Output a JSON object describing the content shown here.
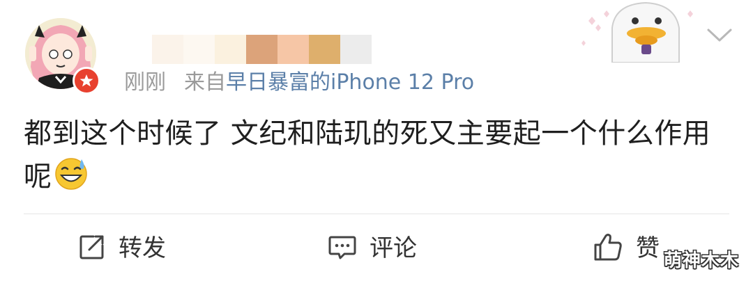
{
  "post": {
    "time": "刚刚",
    "source_prefix": "来自",
    "source_device": "早日暴富的iPhone 12 Pro",
    "text": "都到这个时候了 文纪和陆玑的死又主要起一个什么作用呢",
    "emoji": "sweat-smile-emoji"
  },
  "actions": {
    "repost_label": "转发",
    "comment_label": "评论",
    "like_label": "赞"
  },
  "watermark": "萌神木木",
  "icons": {
    "avatar": "anime-girl-avatar",
    "badge": "verified-badge-icon",
    "sticker": "goose-sticker",
    "menu": "chevron-down-icon",
    "repost": "repost-icon",
    "comment": "comment-icon",
    "like": "thumbs-up-icon"
  },
  "colors": {
    "link": "#5b7fa8",
    "meta": "#9a9a9a",
    "badge": "#e8412f",
    "text": "#1f1f1f"
  }
}
